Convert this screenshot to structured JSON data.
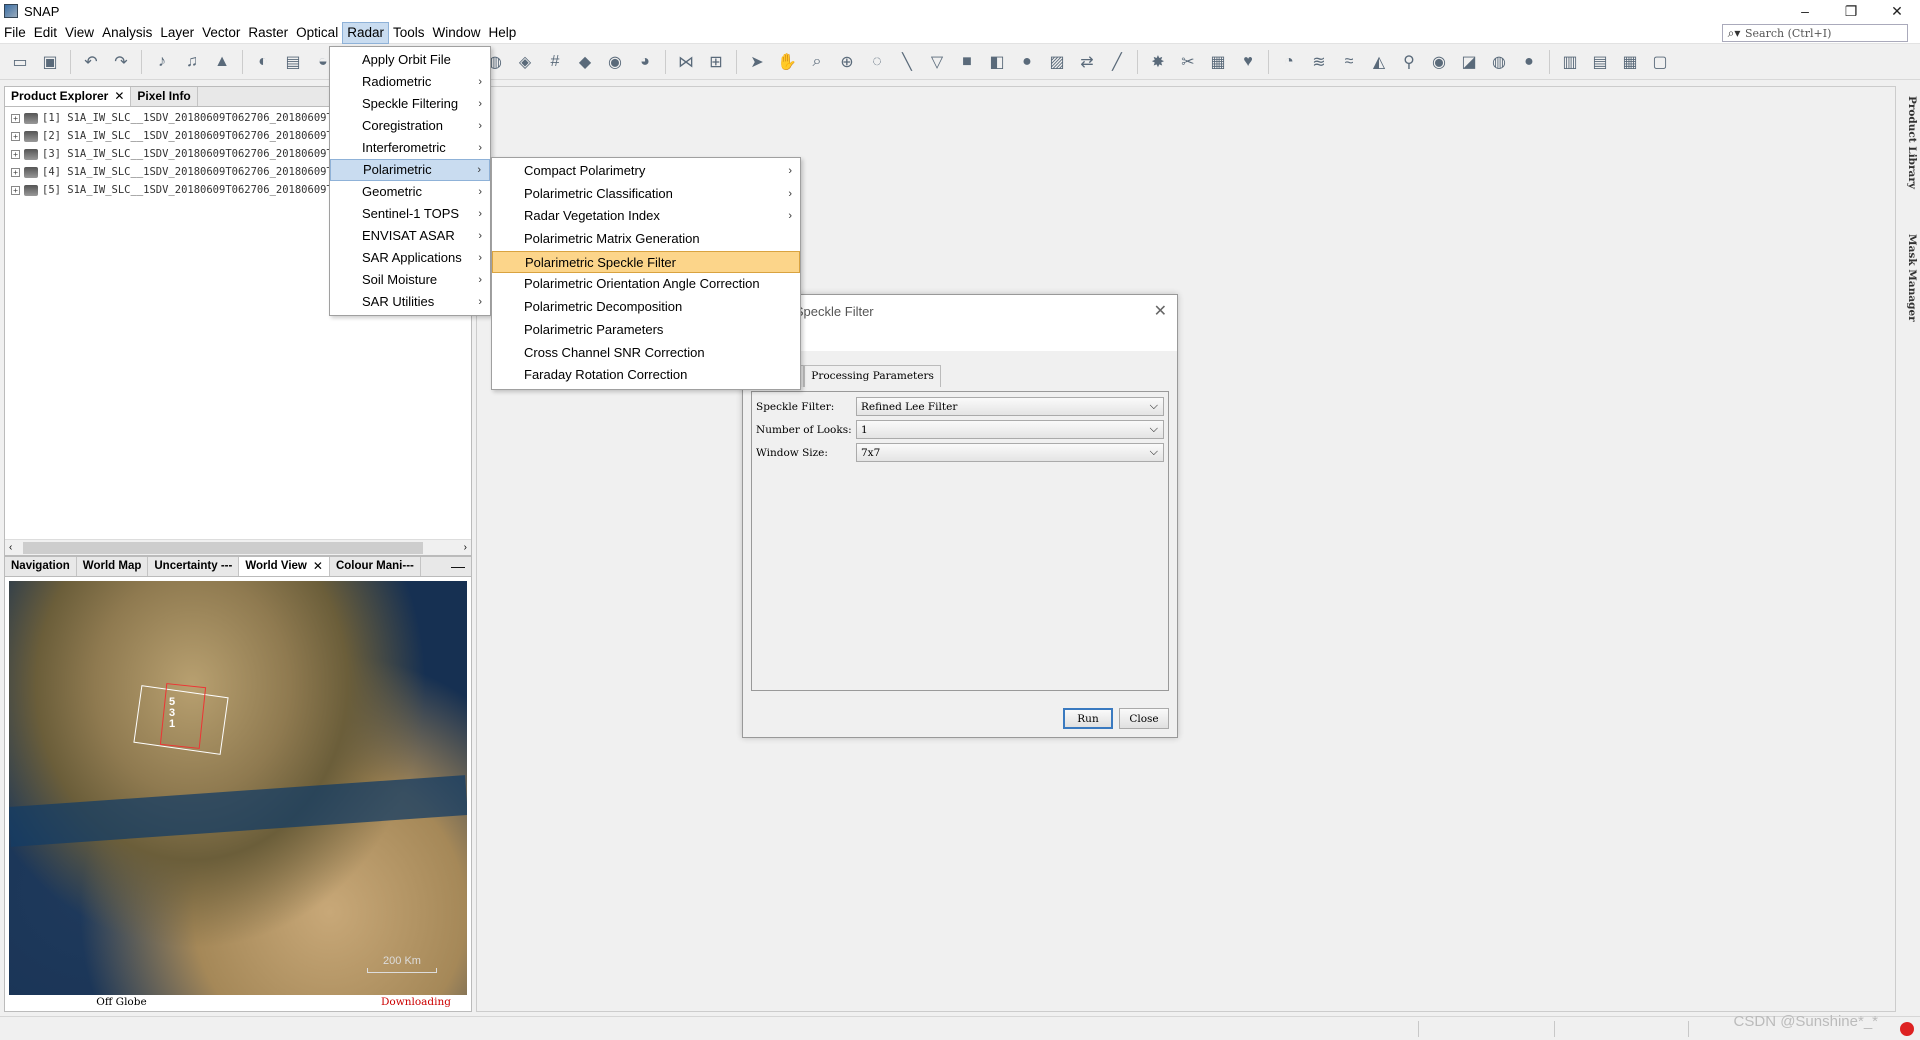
{
  "window": {
    "title": "SNAP",
    "minimize": "–",
    "restore": "❐",
    "close": "✕"
  },
  "menubar": {
    "items": [
      "File",
      "Edit",
      "View",
      "Analysis",
      "Layer",
      "Vector",
      "Raster",
      "Optical",
      "Radar",
      "Tools",
      "Window",
      "Help"
    ],
    "active": "Radar",
    "search_placeholder": "Search (Ctrl+I)"
  },
  "product_explorer": {
    "tabs": [
      {
        "label": "Product Explorer",
        "closable": true
      },
      {
        "label": "Pixel Info",
        "closable": false
      }
    ],
    "products": [
      "[1] S1A_IW_SLC__1SDV_20180609T062706_20180609T0",
      "[2] S1A_IW_SLC__1SDV_20180609T062706_20180609T0",
      "[3] S1A_IW_SLC__1SDV_20180609T062706_20180609T0",
      "[4] S1A_IW_SLC__1SDV_20180609T062706_20180609T0",
      "[5] S1A_IW_SLC__1SDV_20180609T062706_20180609T0"
    ]
  },
  "nav_panel": {
    "tabs": [
      "Navigation",
      "World Map",
      "Uncertainty ---",
      "World View",
      "Colour Mani---"
    ],
    "active_tab": "World View",
    "footprint_labels": [
      "5",
      "3",
      "1"
    ],
    "scale_label": "200 Km",
    "status_left": "Off Globe",
    "status_right": "Downloading"
  },
  "radar_menu": {
    "items": [
      {
        "label": "Apply Orbit File",
        "submenu": false
      },
      {
        "label": "Radiometric",
        "submenu": true
      },
      {
        "label": "Speckle Filtering",
        "submenu": true
      },
      {
        "label": "Coregistration",
        "submenu": true
      },
      {
        "label": "Interferometric",
        "submenu": true
      },
      {
        "label": "Polarimetric",
        "submenu": true
      },
      {
        "label": "Geometric",
        "submenu": true
      },
      {
        "label": "Sentinel-1 TOPS",
        "submenu": true
      },
      {
        "label": "ENVISAT ASAR",
        "submenu": true
      },
      {
        "label": "SAR Applications",
        "submenu": true
      },
      {
        "label": "Soil Moisture",
        "submenu": true
      },
      {
        "label": "SAR Utilities",
        "submenu": true
      }
    ],
    "highlighted": "Polarimetric"
  },
  "polarimetric_menu": {
    "items": [
      {
        "label": "Compact Polarimetry",
        "submenu": true
      },
      {
        "label": "Polarimetric Classification",
        "submenu": true
      },
      {
        "label": "Radar Vegetation Index",
        "submenu": true
      },
      {
        "label": "Polarimetric Matrix Generation",
        "submenu": false
      },
      {
        "label": "Polarimetric Speckle Filter",
        "submenu": false
      },
      {
        "label": "Polarimetric Orientation Angle Correction",
        "submenu": false
      },
      {
        "label": "Polarimetric Decomposition",
        "submenu": false
      },
      {
        "label": "Polarimetric Parameters",
        "submenu": false
      },
      {
        "label": "Cross Channel SNR Correction",
        "submenu": false
      },
      {
        "label": "Faraday Rotation Correction",
        "submenu": false
      }
    ],
    "selected": "Polarimetric Speckle Filter"
  },
  "dialog": {
    "title": "imetric Speckle Filter",
    "menu_label": "lp",
    "tabs": [
      "ameters",
      "Processing Parameters"
    ],
    "active_tab": "Processing Parameters",
    "params": [
      {
        "label": "Speckle Filter:",
        "value": "Refined Lee Filter"
      },
      {
        "label": "Number of Looks:",
        "value": "1"
      },
      {
        "label": "Window Size:",
        "value": "7x7"
      }
    ],
    "run_label": "Run",
    "close_label": "Close"
  },
  "right_strip": {
    "tabs": [
      "Product Library",
      "Mask Manager"
    ]
  },
  "watermark": "CSDN @Sunshine*_*"
}
